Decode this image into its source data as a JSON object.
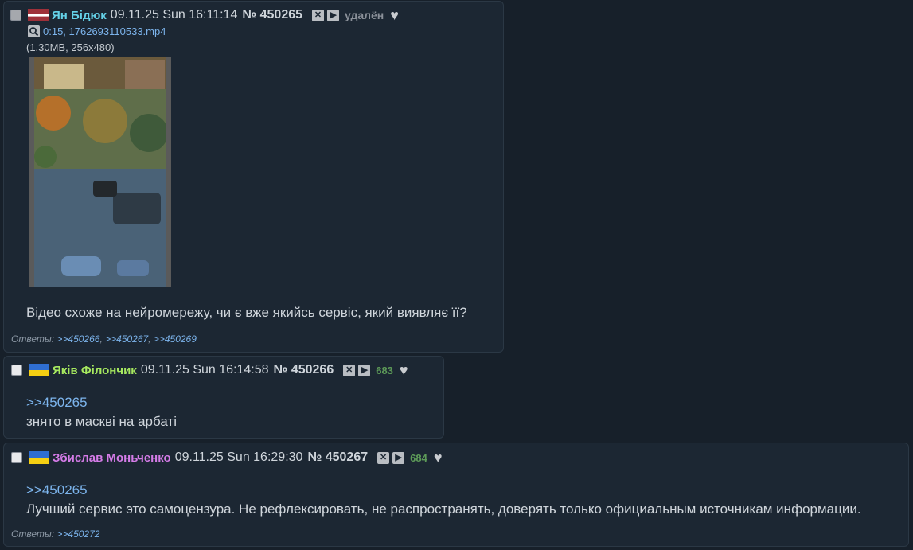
{
  "posts": [
    {
      "author": "Ян Бідюк",
      "author_color": "#65d2e8",
      "flag": "latvia",
      "date": "09.11.25 Sun 16:11:14",
      "number": "№ 450265",
      "status": "удалён",
      "file": {
        "link": "0:15, 1762693110533.mp4",
        "meta": "(1.30MB, 256x480)"
      },
      "text_lines": [
        "Відео схоже на нейромережу, чи є вже якийсь сервіс, який виявляє її?"
      ],
      "answers_label": "Ответы:",
      "answers": [
        ">>450266",
        ">>450267",
        ">>450269"
      ]
    },
    {
      "author": "Яків Філончик",
      "author_color": "#a6e85f",
      "flag": "ukraine",
      "date": "09.11.25 Sun 16:14:58",
      "number": "№ 450266",
      "count": "683",
      "reply_link": ">>450265",
      "text_lines": [
        "знято в маскві на арбаті"
      ]
    },
    {
      "author": "Збислав Моньченко",
      "author_color": "#d57ce8",
      "flag": "ukraine",
      "date": "09.11.25 Sun 16:29:30",
      "number": "№ 450267",
      "count": "684",
      "reply_link": ">>450265",
      "text_lines": [
        "Лучший сервис это самоцензура. Не рефлексировать, не распространять, доверять только официальным источникам информации."
      ],
      "answers_label": "Ответы:",
      "answers": [
        ">>450272"
      ]
    }
  ],
  "colors": {
    "count": "#5d9a58",
    "deleted": "#8a9099",
    "link": "#7cb4ec"
  }
}
